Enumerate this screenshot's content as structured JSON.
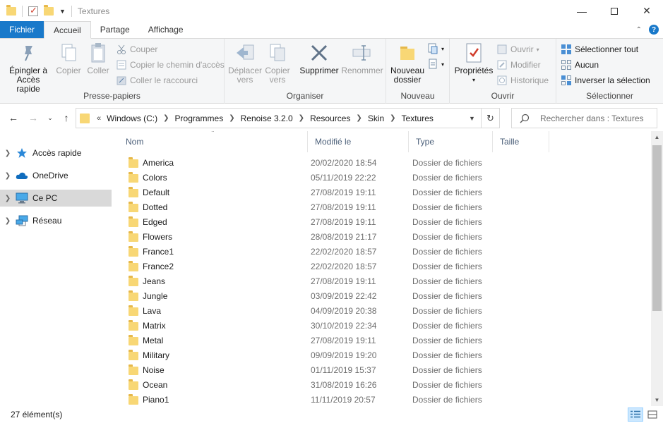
{
  "window": {
    "title": "Textures"
  },
  "tabs": [
    {
      "label": "Fichier"
    },
    {
      "label": "Accueil"
    },
    {
      "label": "Partage"
    },
    {
      "label": "Affichage"
    }
  ],
  "ribbon": {
    "presse_papiers": {
      "label": "Presse-papiers",
      "pin_line1": "Épingler à",
      "pin_line2": "Accès rapide",
      "copy": "Copier",
      "paste": "Coller",
      "cut": "Couper",
      "copy_path": "Copier le chemin d'accès",
      "paste_shortcut": "Coller le raccourci"
    },
    "organiser": {
      "label": "Organiser",
      "move_line1": "Déplacer",
      "move_line2": "vers",
      "copyto_line1": "Copier",
      "copyto_line2": "vers",
      "delete": "Supprimer",
      "rename": "Renommer"
    },
    "nouveau": {
      "label": "Nouveau",
      "new_line1": "Nouveau",
      "new_line2": "dossier"
    },
    "ouvrir": {
      "label": "Ouvrir",
      "properties": "Propriétés",
      "open": "Ouvrir",
      "edit": "Modifier",
      "history": "Historique"
    },
    "selectionner": {
      "label": "Sélectionner",
      "select_all": "Sélectionner tout",
      "select_none": "Aucun",
      "invert": "Inverser la sélection"
    }
  },
  "address": {
    "overflow": "«",
    "crumbs": [
      "Windows (C:)",
      "Programmes",
      "Renoise 3.2.0",
      "Resources",
      "Skin",
      "Textures"
    ],
    "search_placeholder": "Rechercher dans : Textures"
  },
  "navpane": [
    {
      "label": "Accès rapide"
    },
    {
      "label": "OneDrive"
    },
    {
      "label": "Ce PC"
    },
    {
      "label": "Réseau"
    }
  ],
  "columns": {
    "name": "Nom",
    "modified": "Modifié le",
    "type": "Type",
    "size": "Taille"
  },
  "files": [
    {
      "name": "America",
      "modified": "20/02/2020 18:54",
      "type": "Dossier de fichiers"
    },
    {
      "name": "Colors",
      "modified": "05/11/2019 22:22",
      "type": "Dossier de fichiers"
    },
    {
      "name": "Default",
      "modified": "27/08/2019 19:11",
      "type": "Dossier de fichiers"
    },
    {
      "name": "Dotted",
      "modified": "27/08/2019 19:11",
      "type": "Dossier de fichiers"
    },
    {
      "name": "Edged",
      "modified": "27/08/2019 19:11",
      "type": "Dossier de fichiers"
    },
    {
      "name": "Flowers",
      "modified": "28/08/2019 21:17",
      "type": "Dossier de fichiers"
    },
    {
      "name": "France1",
      "modified": "22/02/2020 18:57",
      "type": "Dossier de fichiers"
    },
    {
      "name": "France2",
      "modified": "22/02/2020 18:57",
      "type": "Dossier de fichiers"
    },
    {
      "name": "Jeans",
      "modified": "27/08/2019 19:11",
      "type": "Dossier de fichiers"
    },
    {
      "name": "Jungle",
      "modified": "03/09/2019 22:42",
      "type": "Dossier de fichiers"
    },
    {
      "name": "Lava",
      "modified": "04/09/2019 20:38",
      "type": "Dossier de fichiers"
    },
    {
      "name": "Matrix",
      "modified": "30/10/2019 22:34",
      "type": "Dossier de fichiers"
    },
    {
      "name": "Metal",
      "modified": "27/08/2019 19:11",
      "type": "Dossier de fichiers"
    },
    {
      "name": "Military",
      "modified": "09/09/2019 19:20",
      "type": "Dossier de fichiers"
    },
    {
      "name": "Noise",
      "modified": "01/11/2019 15:37",
      "type": "Dossier de fichiers"
    },
    {
      "name": "Ocean",
      "modified": "31/08/2019 16:26",
      "type": "Dossier de fichiers"
    },
    {
      "name": "Piano1",
      "modified": "11/11/2019 20:57",
      "type": "Dossier de fichiers"
    }
  ],
  "status": {
    "count": "27 élément(s)"
  },
  "colors": {
    "accent": "#1979ca",
    "folder": "#f8d775",
    "selected_nav": "#d9d9d9"
  }
}
